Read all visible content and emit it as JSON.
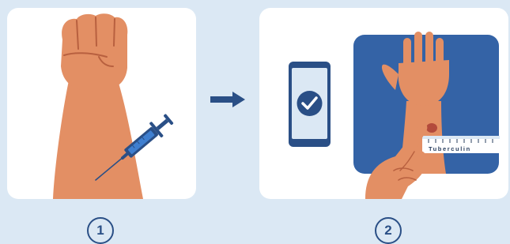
{
  "steps": [
    {
      "number": "1",
      "icon": "injection-arm-illustration"
    },
    {
      "number": "2",
      "icon": "skin-check-illustration"
    }
  ],
  "ruler": {
    "label": "Tuberculin"
  },
  "colors": {
    "background": "#dbe8f4",
    "panel": "#ffffff",
    "navy": "#2a4f86",
    "skin": "#e38f64",
    "blue_panel": "#3463a6",
    "syringe_blue": "#3f7fd0"
  }
}
